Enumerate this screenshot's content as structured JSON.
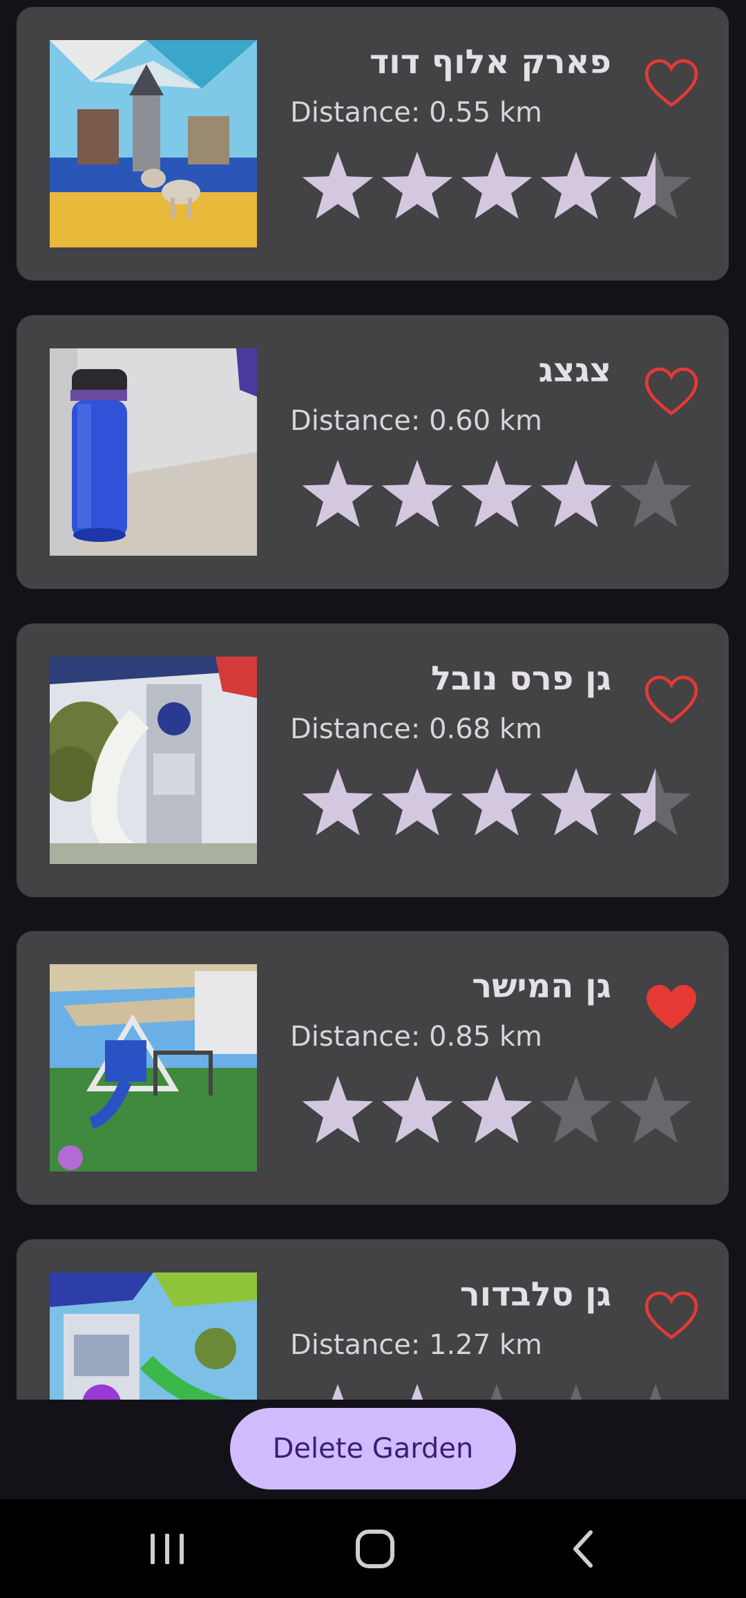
{
  "gardens": [
    {
      "name": "פארק אלוף דוד",
      "distance": "Distance: 0.55 km",
      "rating": 4.5,
      "favorite": false,
      "image": "playground-photo"
    },
    {
      "name": "צגצג",
      "distance": "Distance: 0.60 km",
      "rating": 4,
      "favorite": false,
      "image": "water-bottle-photo"
    },
    {
      "name": "גן פרס נובל",
      "distance": "Distance: 0.68 km",
      "rating": 4.5,
      "favorite": false,
      "image": "rocket-slide-photo"
    },
    {
      "name": "גן המישר",
      "distance": "Distance: 0.85 km",
      "rating": 3,
      "favorite": true,
      "image": "swings-photo"
    },
    {
      "name": "גן סלבדור",
      "distance": "Distance: 1.27 km",
      "rating": 2,
      "favorite": false,
      "image": "colorful-playground-photo"
    }
  ],
  "actions": {
    "delete_label": "Delete Garden"
  },
  "colors": {
    "background": "#141218",
    "card": "#434244",
    "star_filled": "#d3c8e0",
    "star_empty": "#68676b",
    "heart": "#e53935",
    "button": "#d0bcff",
    "button_text": "#3b1e74"
  },
  "icons": {
    "favorite": "heart-icon",
    "rating": "star-icon",
    "nav": [
      "recent-apps-icon",
      "home-icon",
      "back-icon"
    ]
  }
}
